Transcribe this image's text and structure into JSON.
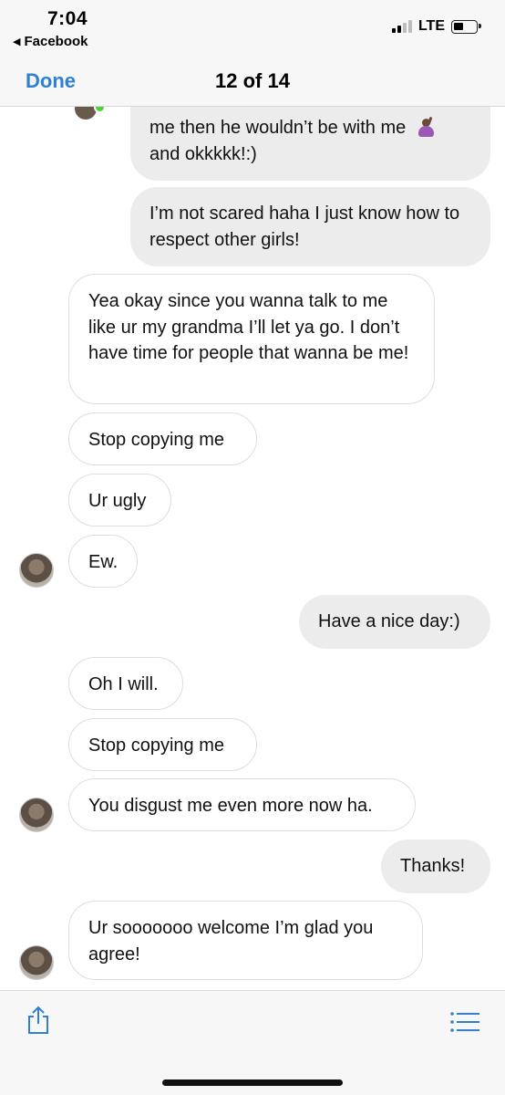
{
  "status_bar": {
    "time": "7:04",
    "back_app": "Facebook",
    "network": "LTE"
  },
  "nav": {
    "done_label": "Done",
    "counter": "12 of 14"
  },
  "messages": [
    {
      "from": "me",
      "text": "me then he wouldn’t be with me"
    },
    {
      "from": "me",
      "text": "and okkkkk!:)"
    },
    {
      "from": "me",
      "text": "I’m not scared haha I just know how to respect other girls!"
    },
    {
      "from": "them",
      "text": "Yea okay since you wanna talk to me like ur my grandma I’ll let ya go. I don’t have time for people that wanna be me!"
    },
    {
      "from": "them",
      "text": "Stop copying me"
    },
    {
      "from": "them",
      "text": "Ur ugly"
    },
    {
      "from": "them",
      "text": "Ew."
    },
    {
      "from": "me",
      "text": "Have a nice day:)"
    },
    {
      "from": "them",
      "text": "Oh I will."
    },
    {
      "from": "them",
      "text": "Stop copying me"
    },
    {
      "from": "them",
      "text": "You disgust me even more now ha."
    },
    {
      "from": "me",
      "text": "Thanks!"
    },
    {
      "from": "them",
      "text": "Ur sooooooo welcome I’m glad you agree!"
    }
  ],
  "colors": {
    "accent": "#2f7fd6",
    "sent_bubble": "#ececec",
    "received_border": "#dedede",
    "online": "#4cd137"
  },
  "icons": [
    "share-icon",
    "list-icon",
    "battery-icon",
    "signal-icon"
  ]
}
